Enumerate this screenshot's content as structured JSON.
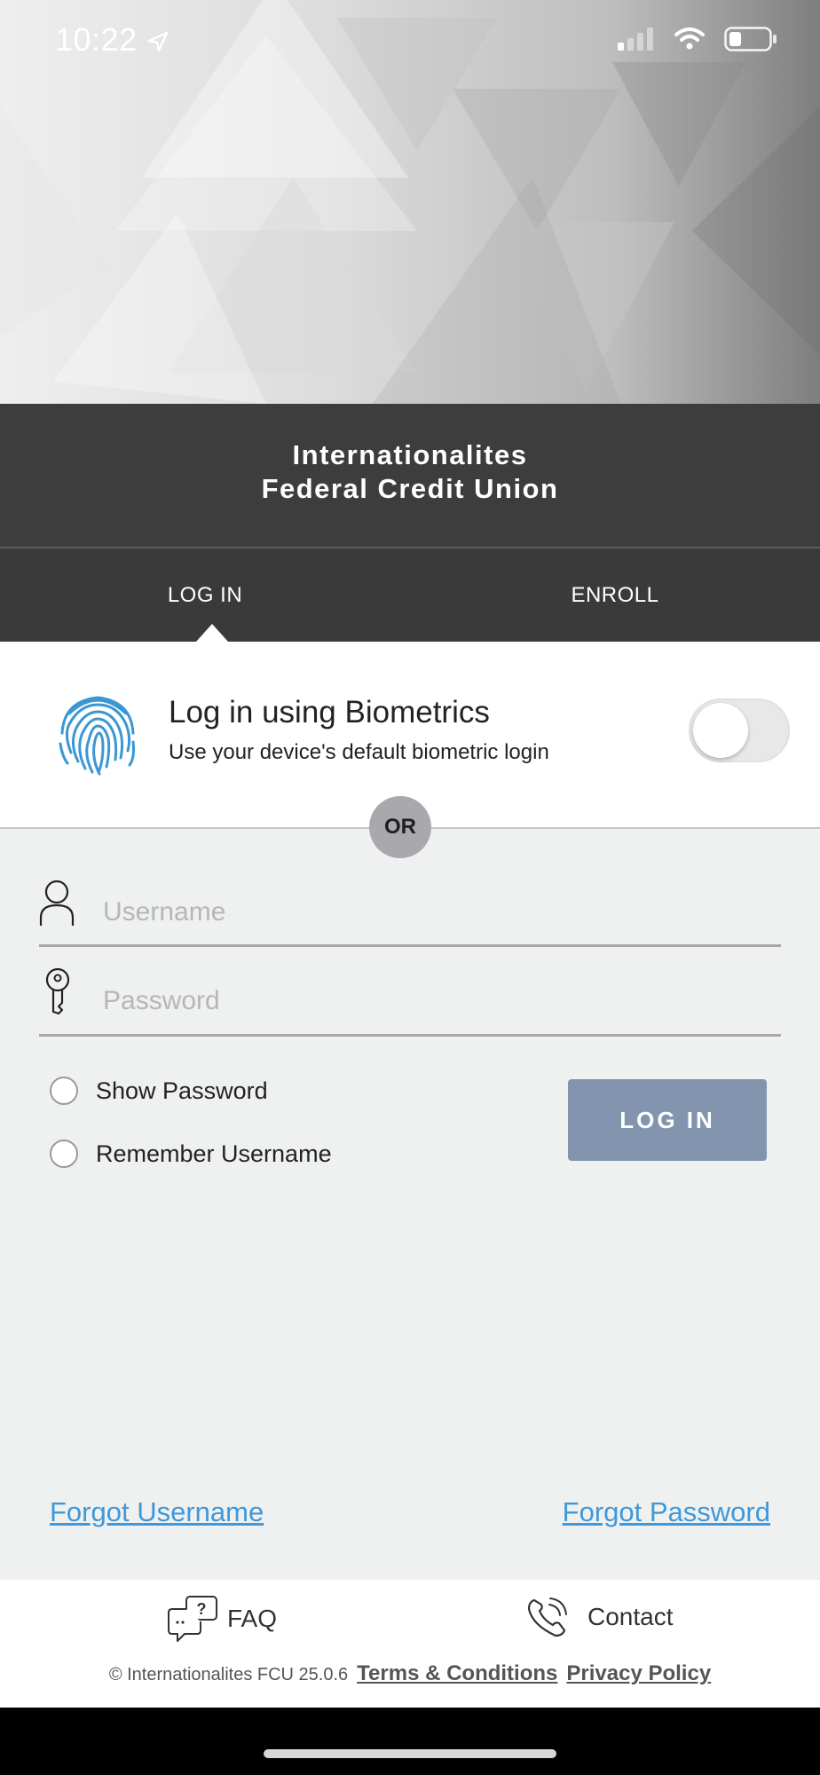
{
  "status_bar": {
    "time": "10:22"
  },
  "brand": {
    "line1": "Internationalites",
    "line2": "Federal Credit Union"
  },
  "tabs": [
    {
      "label": "LOG IN"
    },
    {
      "label": "ENROLL"
    }
  ],
  "biometrics": {
    "title": "Log in using Biometrics",
    "subtitle": "Use your device's default biometric login",
    "enabled": false,
    "icon": "fingerprint-icon"
  },
  "divider": {
    "label": "OR"
  },
  "form": {
    "username_placeholder": "Username",
    "password_placeholder": "Password",
    "show_password_label": "Show Password",
    "remember_username_label": "Remember Username",
    "login_button": "LOG IN"
  },
  "links": {
    "forgot_username": "Forgot Username",
    "forgot_password": "Forgot Password"
  },
  "footer": {
    "faq_label": "FAQ",
    "contact_label": "Contact",
    "copyright": "© Internationalites FCU 25.0.6",
    "terms_label": "Terms & Conditions",
    "privacy_label": "Privacy Policy"
  },
  "colors": {
    "accent_link": "#3f98d9",
    "login_button": "#8395ae",
    "brand_band": "#3d3d3d",
    "fingerprint": "#3a97d4"
  }
}
